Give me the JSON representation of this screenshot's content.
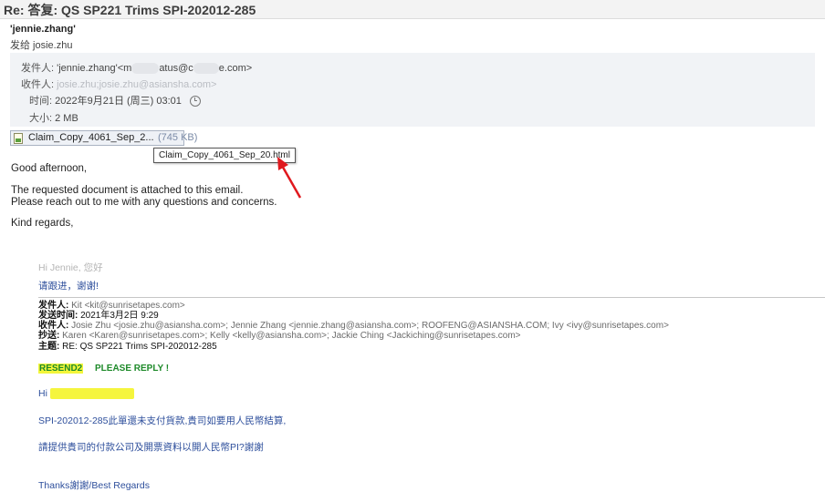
{
  "window": {
    "title": "Re: 答复: QS SP221 Trims SPI-202012-285"
  },
  "sender": {
    "name": "'jennie.zhang'",
    "sent_via": "发给 josie.zhu"
  },
  "header": {
    "from_label": "发件人:",
    "from_value": "'jennie.zhang'<m",
    "from_mid": "atus@c",
    "from_end": "e.com>",
    "to_label": "收件人:",
    "to_value": "josie.zhu;josie.zhu@asiansha.com>",
    "time_label": "时间:",
    "time_value": "2022年9月21日 (周三) 03:01",
    "size_label": "大小:",
    "size_value": "2 MB"
  },
  "attachment": {
    "name": "Claim_Copy_4061_Sep_2...",
    "size": "(745 KB)",
    "tooltip": "Claim_Copy_4061_Sep_20.html",
    "icon": "html-file-icon"
  },
  "body": {
    "greeting": "Good afternoon,",
    "line1": "The requested document is attached to this email.",
    "line2": "Please reach out to me with any questions and concerns.",
    "closing": "Kind regards,"
  },
  "quoted": {
    "hi_line": "Hi Jennie, 您好",
    "follow_up": "请跟进，谢谢!",
    "from_label": "发件人:",
    "from_value": "Kit <kit@sunrisetapes.com>",
    "sent_label": "发送时间:",
    "sent_value": "2021年3月2日 9:29",
    "to_label": "收件人:",
    "to_value": "Josie Zhu <josie.zhu@asiansha.com>; Jennie Zhang <jennie.zhang@asiansha.com>; ROOFENG@ASIANSHA.COM; Ivy <ivy@sunrisetapes.com>",
    "cc_label": "抄送:",
    "cc_value": "Karen <Karen@sunrisetapes.com>; Kelly <kelly@asiansha.com>; Jackie Ching <Jackiching@sunrisetapes.com>",
    "subject_label": "主题:",
    "subject_value": "RE: QS SP221 Trims SPI-202012-285",
    "resend": "RESEND2",
    "please_reply": "PLEASE REPLY !",
    "hi": "Hi",
    "line_spi": "SPI-202012-285此單還未支付貨款,貴司如要用人民幣結算,",
    "line_request": "請提供貴司的付款公司及開票資料以開人民幣PI?謝謝",
    "thanks": "Thanks謝謝/Best Regards"
  },
  "colors": {
    "accent_arrow": "#e0191e",
    "link_blue": "#2e4f9c",
    "highlight": "#f3f63a",
    "resend_green": "#1e8a2a"
  }
}
